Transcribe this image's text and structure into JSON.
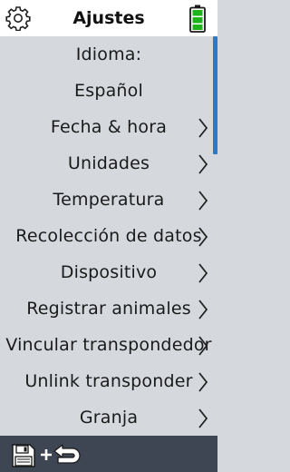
{
  "header": {
    "title": "Ajustes",
    "settings_icon": "gear-icon",
    "battery_icon": "battery-icon",
    "battery_color": "#1db31d"
  },
  "menu": {
    "items": [
      {
        "label": "Idioma:",
        "chevron": false
      },
      {
        "label": "Español",
        "chevron": false
      },
      {
        "label": "Fecha & hora",
        "chevron": true
      },
      {
        "label": "Unidades",
        "chevron": true
      },
      {
        "label": "Temperatura",
        "chevron": true
      },
      {
        "label": "Recolección de datos",
        "chevron": true
      },
      {
        "label": "Dispositivo",
        "chevron": true
      },
      {
        "label": "Registrar animales",
        "chevron": true
      },
      {
        "label": "Vincular transpondedor",
        "chevron": true
      },
      {
        "label": "Unlink transponder",
        "chevron": true
      },
      {
        "label": "Granja",
        "chevron": true
      }
    ]
  },
  "footer": {
    "icons": [
      "save-icon",
      "plus-icon",
      "undo-icon"
    ]
  },
  "colors": {
    "background": "#d5d9de",
    "header": "#ffffff",
    "footer": "#3e4553",
    "scrollbar": "#2a7ac7"
  }
}
